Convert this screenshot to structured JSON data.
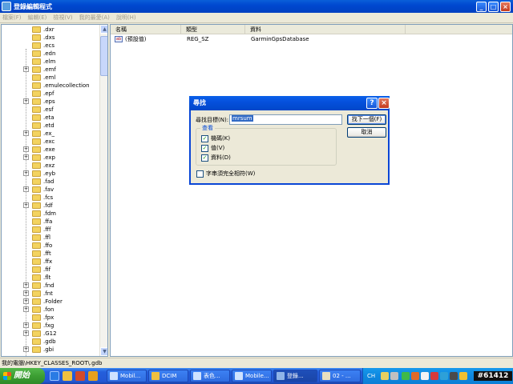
{
  "window": {
    "title": "登錄編輯程式",
    "minimize": "_",
    "maximize": "□",
    "close": "×"
  },
  "menu": [
    "檔案(F)",
    "編輯(E)",
    "檢視(V)",
    "我的最愛(A)",
    "說明(H)"
  ],
  "tree": {
    "items": [
      {
        "label": ".dxr",
        "expandable": false
      },
      {
        "label": ".dxs",
        "expandable": false
      },
      {
        "label": ".ecs",
        "expandable": false
      },
      {
        "label": ".edn",
        "expandable": false
      },
      {
        "label": ".elm",
        "expandable": false
      },
      {
        "label": ".emf",
        "expandable": true
      },
      {
        "label": ".eml",
        "expandable": false
      },
      {
        "label": ".emulecollection",
        "expandable": false
      },
      {
        "label": ".epf",
        "expandable": false
      },
      {
        "label": ".eps",
        "expandable": true
      },
      {
        "label": ".esf",
        "expandable": false
      },
      {
        "label": ".eta",
        "expandable": false
      },
      {
        "label": ".etd",
        "expandable": false
      },
      {
        "label": ".ex_",
        "expandable": true
      },
      {
        "label": ".exc",
        "expandable": false
      },
      {
        "label": ".exe",
        "expandable": true
      },
      {
        "label": ".exp",
        "expandable": true
      },
      {
        "label": ".exz",
        "expandable": false
      },
      {
        "label": ".eyb",
        "expandable": true
      },
      {
        "label": ".fad",
        "expandable": false
      },
      {
        "label": ".fav",
        "expandable": true
      },
      {
        "label": ".fcs",
        "expandable": false
      },
      {
        "label": ".fdf",
        "expandable": true
      },
      {
        "label": ".fdm",
        "expandable": false
      },
      {
        "label": ".ffa",
        "expandable": false
      },
      {
        "label": ".fff",
        "expandable": false
      },
      {
        "label": ".ffl",
        "expandable": false
      },
      {
        "label": ".ffo",
        "expandable": false
      },
      {
        "label": ".fft",
        "expandable": false
      },
      {
        "label": ".ffx",
        "expandable": false
      },
      {
        "label": ".fif",
        "expandable": false
      },
      {
        "label": ".flt",
        "expandable": false
      },
      {
        "label": ".fnd",
        "expandable": true
      },
      {
        "label": ".fnt",
        "expandable": true
      },
      {
        "label": ".Folder",
        "expandable": true
      },
      {
        "label": ".fon",
        "expandable": true
      },
      {
        "label": ".fpx",
        "expandable": false
      },
      {
        "label": ".fxg",
        "expandable": true
      },
      {
        "label": ".G12",
        "expandable": true
      },
      {
        "label": ".gdb",
        "expandable": false
      },
      {
        "label": ".gbi",
        "expandable": true
      }
    ]
  },
  "list": {
    "columns": [
      "名稱",
      "類型",
      "資料"
    ],
    "rows": [
      {
        "icon": "ab",
        "name": "(預設值)",
        "type": "REG_SZ",
        "data": "GarminGpsDatabase"
      }
    ]
  },
  "status": "我的電腦\\HKEY_CLASSES_ROOT\\.gdb",
  "taskbar": {
    "start": "開始",
    "buttons": [
      "Mobil...",
      "DCIM",
      "表色...",
      "Mobile...",
      "登錄...",
      "02 - ..."
    ],
    "tray_lang": "CH",
    "clock": "#61412"
  },
  "dialog": {
    "title": "尋找",
    "help": "?",
    "close": "×",
    "find_label": "尋找目標(N):",
    "find_value": "mrsum",
    "find_next": "找下一個(F)",
    "cancel": "取消",
    "group_title": "查看",
    "options": [
      {
        "label": "機碼(K)",
        "checked": true
      },
      {
        "label": "值(V)",
        "checked": true
      },
      {
        "label": "資料(D)",
        "checked": true
      }
    ],
    "match_whole": "字串須完全相符(W)",
    "match_whole_checked": false
  },
  "colors": {
    "titlebar": "#0048D0",
    "dialog_border": "#0A46D6",
    "selection": "#316AC5"
  }
}
